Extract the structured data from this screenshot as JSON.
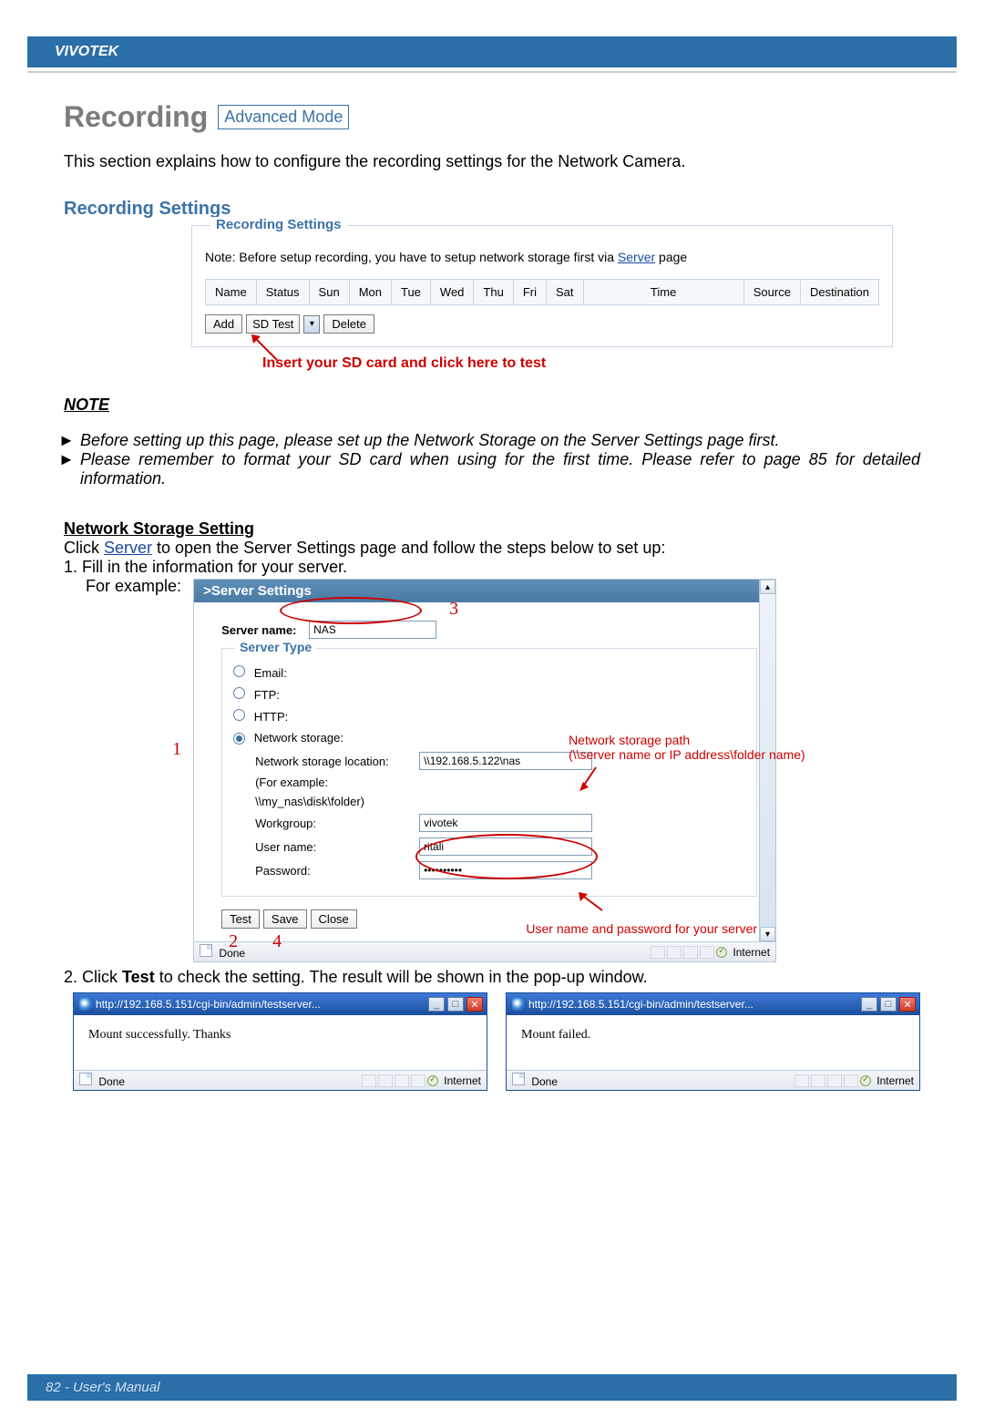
{
  "header": {
    "brand": "VIVOTEK"
  },
  "recording": {
    "title": "Recording",
    "badge": "Advanced Mode",
    "intro": "This section explains how to configure the recording settings for the Network Camera."
  },
  "recset": {
    "heading": "Recording Settings",
    "legend": "Recording Settings",
    "note_prefix": "Note: Before setup recording, you have to setup network storage first via ",
    "note_link": "Server",
    "note_suffix": " page",
    "columns": {
      "name": "Name",
      "status": "Status",
      "sun": "Sun",
      "mon": "Mon",
      "tue": "Tue",
      "wed": "Wed",
      "thu": "Thu",
      "fri": "Fri",
      "sat": "Sat",
      "time": "Time",
      "source": "Source",
      "destination": "Destination"
    },
    "buttons": {
      "add": "Add",
      "sdtest": "SD Test",
      "delete": "Delete"
    },
    "sd_hint": "Insert your SD card and click here to test"
  },
  "note": {
    "heading": "NOTE",
    "item1": "Before setting up this page, please set up the Network Storage on the Server Settings page first.",
    "item2": "Please remember to format your SD card when using for the first time. Please refer to page 85 for detailed information."
  },
  "nstorage": {
    "heading": "Network Storage Setting",
    "line1_pre": "Click ",
    "line1_link": "Server",
    "line1_post": " to open the Server Settings page and follow the steps below to set up:",
    "step1": "1. Fill in the information for your server.",
    "for_example": "For example:"
  },
  "server_settings": {
    "title": ">Server Settings",
    "server_name_label": "Server name:",
    "server_name_value": "NAS",
    "server_type_legend": "Server Type",
    "opt_email": "Email:",
    "opt_ftp": "FTP:",
    "opt_http": "HTTP:",
    "opt_ns": "Network storage:",
    "ns_location_label": "Network storage location:",
    "ns_location_value": "\\\\192.168.5.122\\nas",
    "ns_example_a": "(For example:",
    "ns_example_b": "\\\\my_nas\\disk\\folder)",
    "workgroup_label": "Workgroup:",
    "workgroup_value": "vivotek",
    "username_label": "User name:",
    "username_value": "ritali",
    "password_label": "Password:",
    "password_value": "••••••••••",
    "btn_test": "Test",
    "btn_save": "Save",
    "btn_close": "Close",
    "callout_ns_path_a": "Network storage path",
    "callout_ns_path_b": "(\\\\server name or IP address\\folder name)",
    "callout_userpass": "User name and password for your server",
    "status_done": "Done",
    "status_internet": "Internet",
    "num1": "1",
    "num2": "2",
    "num3": "3",
    "num4": "4"
  },
  "step2": {
    "text_pre": "2. Click ",
    "text_bold": "Test",
    "text_post": " to check the setting. The result will be shown in the pop-up window."
  },
  "popups": {
    "titlebar_url": "http://192.168.5.151/cgi-bin/admin/testserver...",
    "success_body": "Mount successfully. Thanks",
    "fail_body": "Mount failed.",
    "status_done": "Done",
    "status_internet": "Internet"
  },
  "footer": {
    "text": "82 - User's Manual"
  }
}
